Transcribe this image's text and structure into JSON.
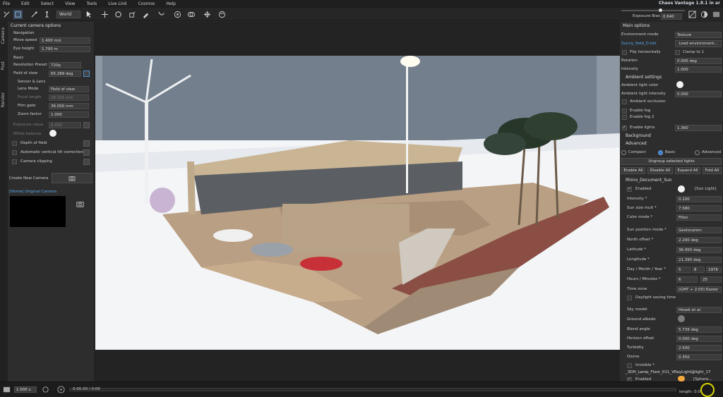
{
  "menu": [
    "File",
    "Edit",
    "Select",
    "View",
    "Tools",
    "Live Link",
    "Cosmos",
    "Help"
  ],
  "app_title": "Chaos Vantage 1.8.1 in ar",
  "toolbar": {
    "space": "World"
  },
  "exposure": {
    "label": "Exposure Bias",
    "value": "0.640"
  },
  "vtabs": [
    "Camera",
    "Post",
    "Render"
  ],
  "left": {
    "section": "Current camera options",
    "navigation": "Navigation",
    "move_speed_label": "Move speed",
    "move_speed": "1.400 m/s",
    "eye_height_label": "Eye height",
    "eye_height": "1.700 m",
    "basic": "Basic",
    "res_label": "Resolution Preset",
    "res": "720p",
    "fov_label": "Field of view",
    "fov": "65.289 deg",
    "sensor": "Sensor & Lens",
    "lens_label": "Lens Mode",
    "lens": "Field of view",
    "focal_label": "Focal length",
    "focal": "26.325 mm",
    "film_label": "Film gate",
    "film": "36.000 mm",
    "zoom_label": "Zoom factor",
    "zoom": "1.000",
    "exposure_label": "Exposure value",
    "exposure_value": "8.000",
    "wb_label": "White balance",
    "dof_label": "Depth of field",
    "avtc_label": "Automatic vertical tilt correction",
    "clip_label": "Camera clipping",
    "create_camera": "Create New Camera",
    "camera_name": "[Home] Original Camera"
  },
  "right": {
    "main_options": "Main options",
    "env_mode_label": "Environment mode",
    "env_mode": "Texture",
    "hdr_name": "Sunny_field_D.hdr",
    "load_env": "Load environment...",
    "flip_label": "Flip horizontally",
    "clamp_label": "Clamp to 1",
    "rotation_label": "Rotation",
    "rotation": "0.000 deg",
    "intensity_label": "Intensity",
    "intensity": "1.000",
    "ambient_settings": "Ambient settings",
    "amb_color_label": "Ambient light color",
    "amb_int_label": "Ambient light intensity",
    "amb_int": "0.000",
    "amb_occ_label": "Ambient occlusion",
    "fog_label": "Enable fog",
    "fog2_label": "Enable fog 2",
    "lights_label": "Enable lights",
    "lights": "1.360",
    "background": "Background",
    "advanced": "Advanced",
    "modes": [
      "Compact",
      "Basic",
      "Advanced"
    ],
    "ungroup": "Ungroup selected lights",
    "light_btns": [
      "Enable All",
      "Disable All",
      "Expand All",
      "Fold All"
    ],
    "sun_name": "Rhino_Document_Sun",
    "enabled_label": "Enabled",
    "sun_type": "[Sun Light]",
    "sun_int_label": "Intensity *",
    "sun_int": "0.100",
    "sun_size_label": "Sun size mult *",
    "sun_size": "7.580",
    "color_mode_label": "Color mode *",
    "color_mode": "Filter",
    "sun_pos_label": "Sun position mode *",
    "sun_pos": "Geolocation",
    "north_label": "North offset *",
    "north": "2.200 deg",
    "lat_label": "Latitude *",
    "lat": "36.950 deg",
    "lon_label": "Longitude *",
    "lon": "21.395 deg",
    "date_label": "Day / Month / Year *",
    "day": "5",
    "month": "8",
    "year": "1976",
    "time_label": "Hours / Minutes *",
    "hours": "6",
    "minutes": "25",
    "tz_label": "Time zone",
    "tz": "(GMT + 2:00) Easter",
    "dst_label": "Daylight saving time",
    "sky_label": "Sky model",
    "sky": "Hosek et al.",
    "albedo_label": "Ground albedo",
    "blend_label": "Blend angle",
    "blend": "5.739 deg",
    "horizon_label": "Horizon offset",
    "horizon": "0.000 deg",
    "turb_label": "Turbidity",
    "turb": "2.500",
    "ozone_label": "Ozone",
    "ozone": "0.350",
    "invisible_label": "Invisible *",
    "lamp_name": "_3DH_Lamp_Floor_011_VRayLight@light_17",
    "lamp_enabled": "Enabled",
    "lamp_type": "[Sphere..."
  },
  "timeline": {
    "speed": "1.000 x",
    "time": "0:00.00 / 0:00",
    "length": "length: 0:00.00"
  }
}
